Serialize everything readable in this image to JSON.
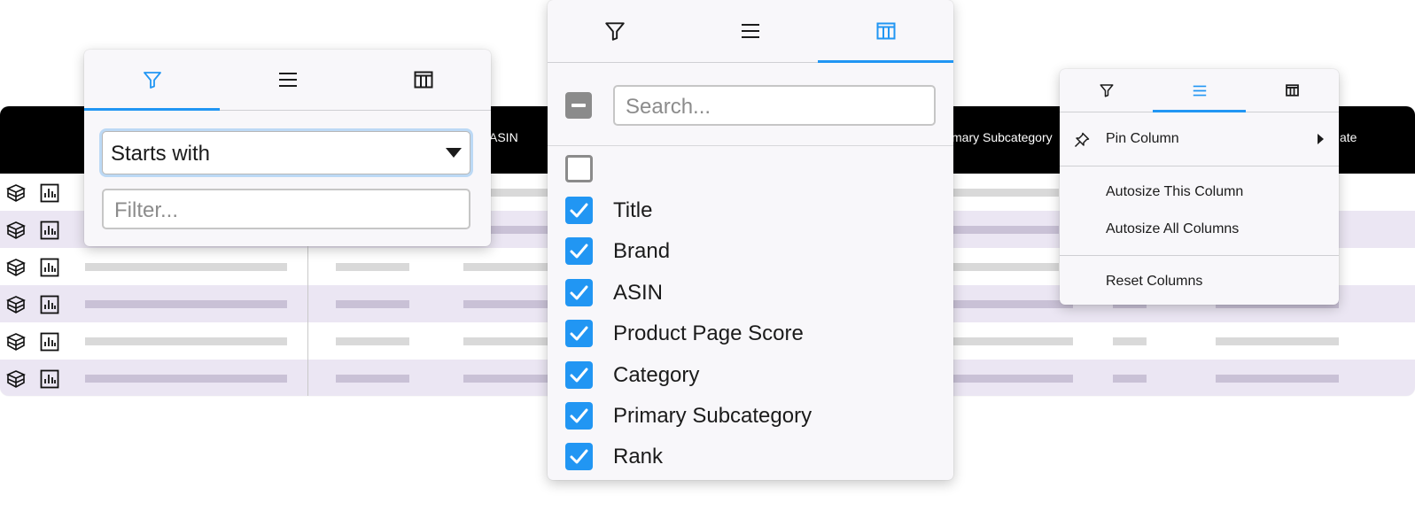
{
  "grid": {
    "headers": {
      "asin": "ASIN",
      "primary_subcategory": "mary Subcategory",
      "date": "ate"
    }
  },
  "filter_panel": {
    "tabs": [
      "filter-icon",
      "menu-icon",
      "columns-icon"
    ],
    "active_tab": "filter",
    "condition_selected": "Starts with",
    "filter_placeholder": "Filter..."
  },
  "columns_panel": {
    "tabs": [
      "filter-icon",
      "menu-icon",
      "columns-icon"
    ],
    "active_tab": "columns",
    "search_placeholder": "Search...",
    "columns": [
      {
        "label": "Title",
        "checked": true
      },
      {
        "label": "Brand",
        "checked": true
      },
      {
        "label": "ASIN",
        "checked": true
      },
      {
        "label": "Product Page Score",
        "checked": true
      },
      {
        "label": "Category",
        "checked": true
      },
      {
        "label": "Primary Subcategory",
        "checked": true
      },
      {
        "label": "Rank",
        "checked": true
      }
    ]
  },
  "menu_panel": {
    "tabs": [
      "filter-icon",
      "menu-icon",
      "columns-icon"
    ],
    "active_tab": "menu",
    "items": {
      "pin_column": "Pin Column",
      "autosize_this": "Autosize This Column",
      "autosize_all": "Autosize All Columns",
      "reset_columns": "Reset Columns"
    }
  },
  "colors": {
    "accent": "#2196f3",
    "row_alt": "#ebe6f3",
    "header_bg": "#000000"
  }
}
